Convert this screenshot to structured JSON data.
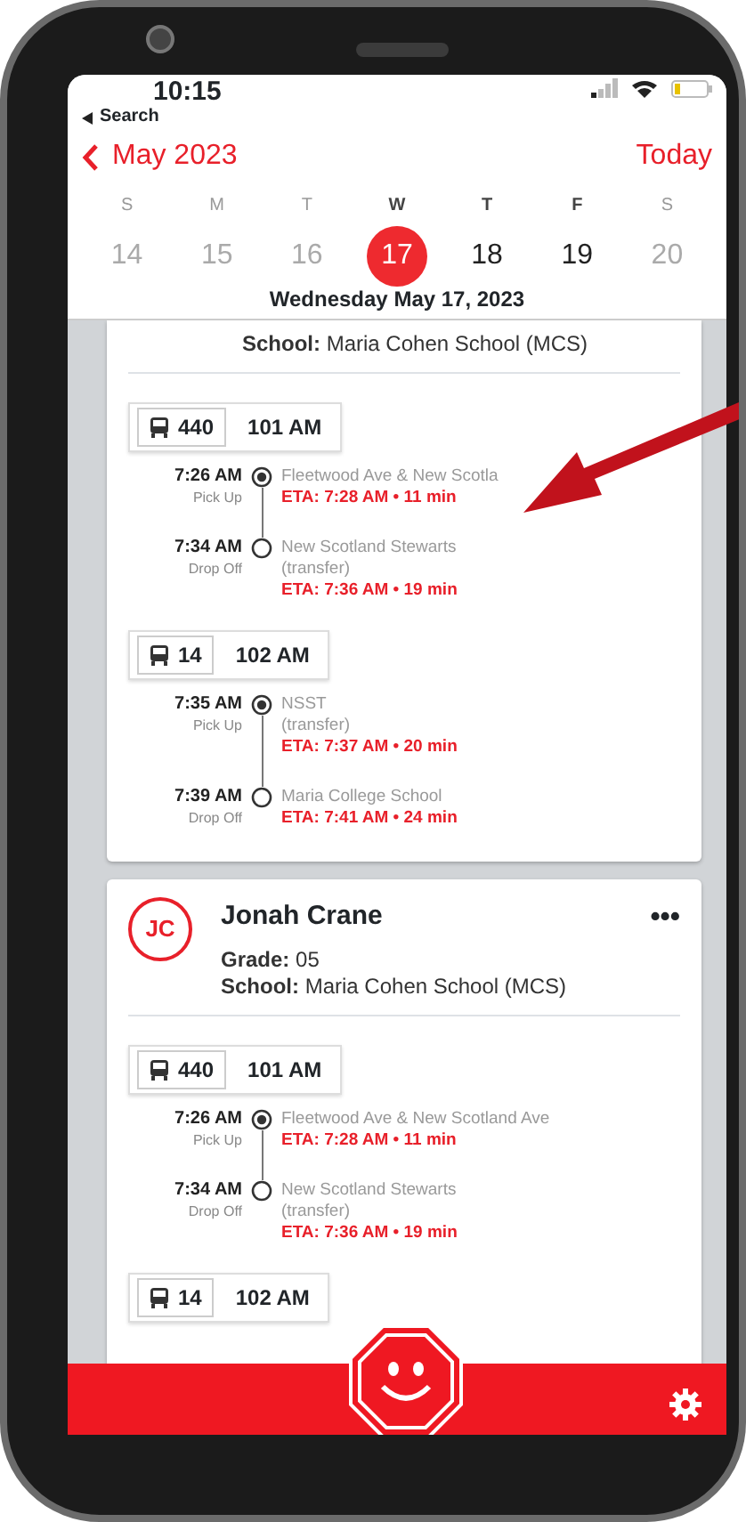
{
  "status_bar": {
    "time": "10:15",
    "back_label": "Search"
  },
  "header": {
    "month": "May 2023",
    "today": "Today"
  },
  "week": [
    {
      "letter": "S",
      "date": "14",
      "selected": false,
      "dimmed": true
    },
    {
      "letter": "M",
      "date": "15",
      "selected": false,
      "dimmed": true
    },
    {
      "letter": "T",
      "date": "16",
      "selected": false,
      "dimmed": true
    },
    {
      "letter": "W",
      "date": "17",
      "selected": true,
      "dimmed": false
    },
    {
      "letter": "T",
      "date": "18",
      "selected": false,
      "dimmed": false
    },
    {
      "letter": "F",
      "date": "19",
      "selected": false,
      "dimmed": false
    },
    {
      "letter": "S",
      "date": "20",
      "selected": false,
      "dimmed": true
    }
  ],
  "date_title": "Wednesday May 17, 2023",
  "students": [
    {
      "school": "**School:** Maria Cohen School (MCS)",
      "trips": [
        {
          "bus": "440",
          "route": "101 AM",
          "stops": [
            {
              "time": "7:26 AM",
              "type": "Pick Up",
              "place": "Fleetwood Ave & New Scotla",
              "eta": "ETA: 7:28 AM • 11 min",
              "current": true
            },
            {
              "time": "7:34 AM",
              "type": "Drop Off",
              "place": "New Scotland Stewarts",
              "note": "(transfer)",
              "eta": "ETA: 7:36 AM • 19 min",
              "current": false
            }
          ]
        },
        {
          "bus": "14",
          "route": "102 AM",
          "stops": [
            {
              "time": "7:35 AM",
              "type": "Pick Up",
              "place": "NSST",
              "note": "(transfer)",
              "eta": "ETA: 7:37 AM • 20 min",
              "current": true
            },
            {
              "time": "7:39 AM",
              "type": "Drop Off",
              "place": "Maria College School",
              "eta": "ETA: 7:41 AM • 24 min",
              "current": false
            }
          ]
        }
      ]
    },
    {
      "initials": "JC",
      "name": "Jonah Crane",
      "menu": "•••",
      "grade": "**Grade:** 05",
      "school": "**School:** Maria Cohen School (MCS)",
      "trips": [
        {
          "bus": "440",
          "route": "101 AM",
          "stops": [
            {
              "time": "7:26 AM",
              "type": "Pick Up",
              "place": "Fleetwood Ave & New Scotland Ave",
              "eta": "ETA: 7:28 AM • 11 min",
              "current": true
            },
            {
              "time": "7:34 AM",
              "type": "Drop Off",
              "place": "New Scotland Stewarts",
              "note": "(transfer)",
              "eta": "ETA: 7:36 AM • 19 min",
              "current": false
            }
          ]
        },
        {
          "bus": "14",
          "route": "102 AM"
        }
      ]
    }
  ]
}
